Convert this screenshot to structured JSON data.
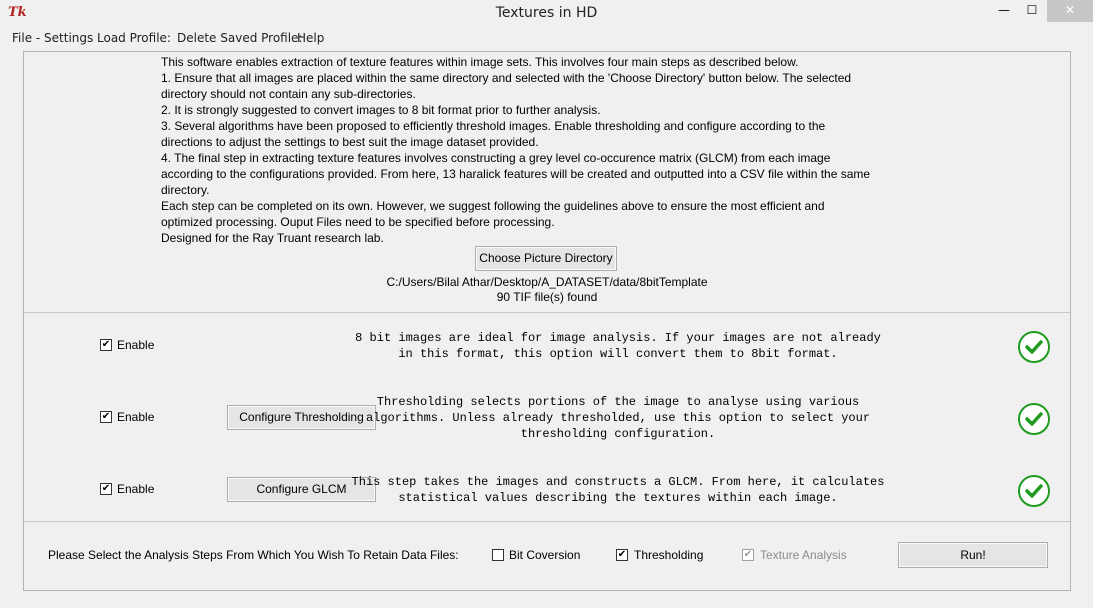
{
  "window": {
    "title": "Textures in HD",
    "logo": "Tk",
    "controls": {
      "minimize": "—",
      "maximize": "☐",
      "close": "✕"
    }
  },
  "menu": [
    "File - Settings",
    "Load Profile:",
    "Delete Saved Profile:",
    "Help"
  ],
  "intro_lines": [
    "This software enables extraction of texture features within image sets. This involves four main steps as described below.",
    "1. Ensure that all images are placed within the same directory and selected with the 'Choose Directory' button below. The selected",
    "directory should not contain any sub-directories.",
    "2. It is strongly suggested to convert images to 8 bit format prior to further analysis.",
    "3. Several algorithms have been proposed to efficiently threshold images. Enable thresholding and configure according to the",
    "directions to adjust the settings to best suit the image dataset provided.",
    "4. The final step in extracting texture features involves constructing a grey level co-occurence matrix (GLCM) from each image",
    "according to the configurations provided. From here, 13 haralick features will be created and outputted into a CSV file within the same",
    "directory.",
    "Each step can be completed on its own. However, we suggest following the guidelines above to ensure the most efficient and",
    "optimized processing. Ouput Files need to be specified before processing.",
    "Designed for the Ray Truant research lab."
  ],
  "directory": {
    "button_label": "Choose Picture Directory",
    "path": "C:/Users/Bilal Athar/Desktop/A_DATASET/data/8bitTemplate",
    "count": "90 TIF file(s) found"
  },
  "steps": {
    "convert": {
      "enable_label": "Enable",
      "checked": "✔",
      "desc_lines": [
        "8 bit images are ideal for image analysis. If your images are not already",
        "in this format, this option will convert them to 8bit format."
      ]
    },
    "threshold": {
      "enable_label": "Enable",
      "checked": "✔",
      "button_label": "Configure Thresholding",
      "desc_lines": [
        "Thresholding selects portions of the image to analyse using various",
        "algorithms. Unless already thresholded, use this option to select your",
        "thresholding configuration."
      ]
    },
    "glcm": {
      "enable_label": "Enable",
      "checked": "✔",
      "button_label": "Configure GLCM",
      "desc_lines": [
        "This step takes the images and constructs a GLCM. From here, it calculates",
        "statistical values describing the textures within each image."
      ]
    }
  },
  "retain": {
    "label": "Please Select the Analysis Steps From Which You Wish To Retain Data Files:",
    "options": [
      {
        "label": "Bit Coversion",
        "checked": ""
      },
      {
        "label": "Thresholding",
        "checked": "✔"
      },
      {
        "label": "Texture Analysis",
        "checked": "✔"
      }
    ],
    "run_label": "Run!"
  },
  "colors": {
    "check_green": "#1f9a1f",
    "background": "#f0f0f0"
  }
}
